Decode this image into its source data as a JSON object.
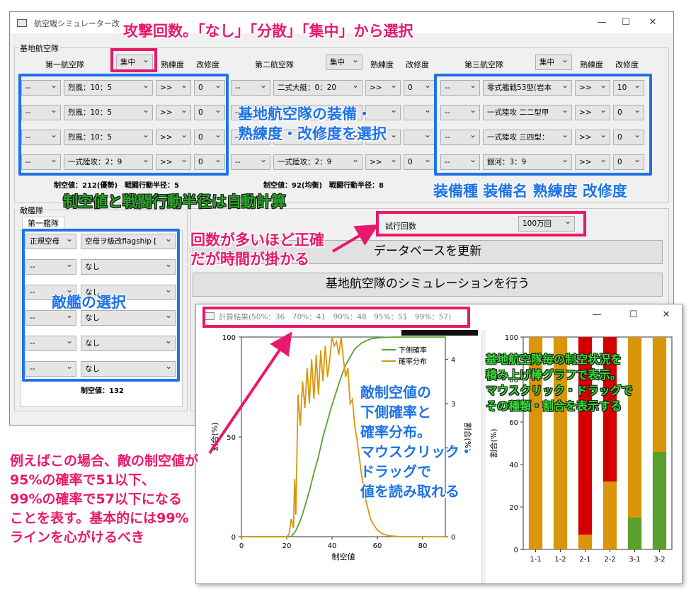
{
  "window": {
    "title": "航空戦シミュレーター改",
    "min_icon": "minimize-icon",
    "max_icon": "maximize-icon",
    "close_icon": "close-icon"
  },
  "base_group_label": "基地航空隊",
  "squadrons": [
    {
      "label": "第一航空隊",
      "mode": "集中",
      "prof_label": "熟練度",
      "imp_label": "改修度",
      "rows": [
        {
          "type": "--",
          "name": "烈風：10：5",
          "prof": ">>",
          "imp": "0"
        },
        {
          "type": "--",
          "name": "烈風：10：5",
          "prof": ">>",
          "imp": "0"
        },
        {
          "type": "--",
          "name": "烈風：10：5",
          "prof": ">>",
          "imp": "0"
        },
        {
          "type": "--",
          "name": "一式陸攻：2：9",
          "prof": ">>",
          "imp": "0"
        }
      ],
      "summary": "制空値：212(優勢)　戦闘行動半径：5"
    },
    {
      "label": "第二航空隊",
      "mode": "集中",
      "prof_label": "熟練度",
      "imp_label": "改修度",
      "rows": [
        {
          "type": "--",
          "name": "二式大艇：0：20",
          "prof": ">>",
          "imp": "0"
        },
        {
          "type": "--",
          "name": "",
          "prof": "",
          "imp": ""
        },
        {
          "type": "--",
          "name": "",
          "prof": "",
          "imp": ""
        },
        {
          "type": "--",
          "name": "一式陸攻：2：9",
          "prof": ">>",
          "imp": "0"
        }
      ],
      "summary": "制空値：92(均衡)　戦闘行動半径：8"
    },
    {
      "label": "第三航空隊",
      "mode": "集中",
      "prof_label": "熟練度",
      "imp_label": "改修度",
      "rows": [
        {
          "type": "--",
          "name": "零式艦戦53型(岩本",
          "prof": ">>",
          "imp": "10"
        },
        {
          "type": "--",
          "name": "一式陸攻 二二型甲",
          "prof": ">>",
          "imp": "0"
        },
        {
          "type": "--",
          "name": "一式陸攻 三四型：",
          "prof": ">>",
          "imp": "0"
        },
        {
          "type": "--",
          "name": "銀河：3：9",
          "prof": ">>",
          "imp": "0"
        }
      ],
      "summary": ""
    }
  ],
  "enemy": {
    "group_label": "敵艦隊",
    "tab": "第一艦隊",
    "rows": [
      {
        "type": "正規空母",
        "name": "空母ヲ級改flagship ["
      },
      {
        "type": "--",
        "name": "なし"
      },
      {
        "type": "--",
        "name": "なし"
      },
      {
        "type": "--",
        "name": "なし"
      },
      {
        "type": "--",
        "name": "なし"
      },
      {
        "type": "--",
        "name": "なし"
      }
    ],
    "summary": "制空値：132"
  },
  "trial": {
    "label": "試行回数",
    "value": "100万回"
  },
  "buttons": {
    "update_db": "データベースを更新",
    "simulate": "基地航空隊のシミュレーションを行う"
  },
  "result_window": {
    "title": "計算結果(50%：36　70%：41　90%：48　95%：51　99%：57)"
  },
  "annotations": {
    "top": "攻撃回数。「なし」「分散」「集中」から選択",
    "equip_1": "基地航空隊の装備・",
    "equip_2": "熟練度・改修度を選択",
    "auto": "制空値と戦闘行動半径は自動計算",
    "cols": "装備種 装備名 熟練度 改修度",
    "trial_1": "回数が多いほど正確",
    "trial_2": "だが時間が掛かる",
    "enemy": "敵艦の選択",
    "chart1_1": "敵制空値の",
    "chart1_2": "下側確率と",
    "chart1_3": "確率分布。",
    "chart1_4": "マウスクリック・",
    "chart1_5": "ドラッグで",
    "chart1_6": "値を読み取れる",
    "chart2_1": "基地航空隊毎の制空状況を",
    "chart2_2": "積み上げ棒グラフで表示。",
    "chart2_3": "マウスクリック・ドラッグで",
    "chart2_4": "その種類・割合を表示する",
    "ex_1": "例えばこの場合、敵の制空値が",
    "ex_2": "95%の確率で51以下、",
    "ex_3": "99%の確率で57以下になる",
    "ex_4": "ことを表す。基本的には99%",
    "ex_5": "ラインを心がけるべき"
  },
  "chart_data": [
    {
      "type": "line",
      "xlabel": "制空値",
      "ylabel": "割合(%)",
      "y2label": "割合(%)",
      "xlim": [
        0,
        90
      ],
      "ylim": [
        0,
        100
      ],
      "y2lim": [
        0,
        4.5
      ],
      "xticks": [
        0,
        20,
        40,
        60,
        80
      ],
      "yticks": [
        0,
        50,
        100
      ],
      "y2ticks": [
        0,
        1,
        2,
        3,
        4
      ],
      "legend_position": "top-right",
      "series": [
        {
          "name": "下側確率",
          "axis": "left",
          "color": "#5aa02c",
          "x": [
            0,
            22,
            24,
            26,
            28,
            30,
            32,
            34,
            36,
            38,
            40,
            42,
            44,
            46,
            48,
            50,
            51,
            53,
            55,
            57,
            60,
            65,
            70,
            80,
            90
          ],
          "y": [
            0,
            0,
            3,
            8,
            15,
            23,
            32,
            40,
            50,
            58,
            66,
            73,
            80,
            86,
            90,
            94,
            95,
            97,
            98,
            99,
            99.6,
            99.9,
            100,
            100,
            100
          ]
        },
        {
          "name": "確率分布",
          "axis": "right",
          "color": "#d9960a",
          "x": [
            0,
            20,
            21,
            22,
            23,
            23.5,
            24,
            25,
            26,
            27,
            28,
            29,
            30,
            31,
            32,
            33,
            34,
            35,
            36,
            37,
            38,
            39,
            40,
            41,
            42,
            43,
            44,
            45,
            46,
            47,
            48,
            49,
            50,
            51,
            52,
            53,
            54,
            55,
            56,
            57,
            58,
            60,
            62,
            65,
            70,
            80,
            90
          ],
          "y": [
            0,
            0,
            0.05,
            0.4,
            0.2,
            1.3,
            0.5,
            3.2,
            2.5,
            3.5,
            2.9,
            3.8,
            3.0,
            4.0,
            3.1,
            4.1,
            3.2,
            4.2,
            3.5,
            4.3,
            3.6,
            4.0,
            4.5,
            4.3,
            4.4,
            4.1,
            4.5,
            4.0,
            3.6,
            3.8,
            3.0,
            3.1,
            2.5,
            2.2,
            1.8,
            1.4,
            1.1,
            0.8,
            0.6,
            0.4,
            0.3,
            0.15,
            0.07,
            0.02,
            0,
            0,
            0
          ]
        }
      ]
    },
    {
      "type": "bar",
      "stacked": true,
      "ylabel": "割合(%)",
      "ylim": [
        0,
        100
      ],
      "yticks": [
        0,
        20,
        40,
        60,
        80,
        100
      ],
      "categories": [
        "1-1",
        "1-2",
        "2-1",
        "2-2",
        "3-1",
        "3-2"
      ],
      "series": [
        {
          "color": "#5aa02c",
          "values": [
            0,
            0,
            0,
            0,
            15,
            46
          ]
        },
        {
          "color": "#d9960a",
          "values": [
            100,
            100,
            7,
            32,
            85,
            54
          ]
        },
        {
          "color": "#d40000",
          "values": [
            0,
            0,
            93,
            68,
            0,
            0
          ]
        }
      ]
    }
  ]
}
